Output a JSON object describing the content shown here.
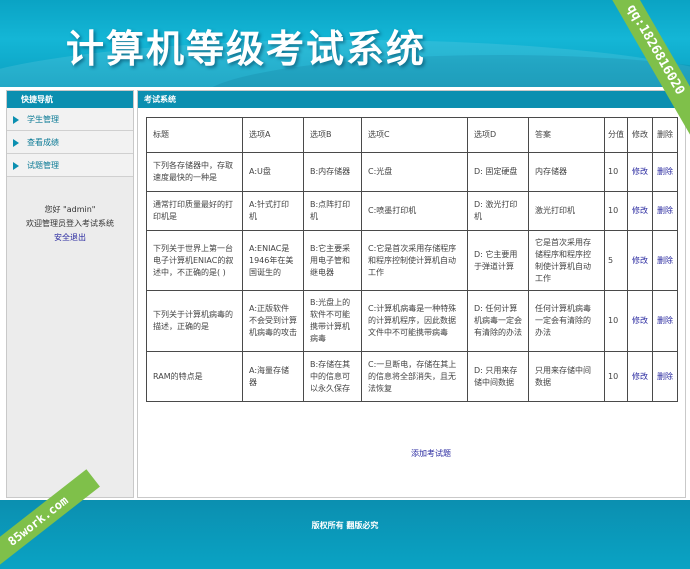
{
  "header": {
    "title": "计算机等级考试系统"
  },
  "watermarks": {
    "top_right": "qq:1826816020",
    "bottom_left": "85work.com"
  },
  "sidebar": {
    "heading": "快捷导航",
    "items": [
      {
        "label": "学生管理"
      },
      {
        "label": "查看成绩"
      },
      {
        "label": "试题管理"
      }
    ],
    "welcome_line1": "您好 \"admin\"",
    "welcome_line2": "欢迎管理员登入考试系统",
    "logout": "安全退出"
  },
  "main": {
    "heading": "考试系统",
    "table": {
      "headers": [
        "标题",
        "选项A",
        "选项B",
        "选项C",
        "选项D",
        "答案",
        "分值",
        "修改",
        "删除"
      ],
      "rows": [
        [
          "下列各存储器中，存取速度最快的一种是",
          "A:U盘",
          "B:内存储器",
          "C:光盘",
          "D: 固定硬盘",
          "内存储器",
          "10",
          "修改",
          "删除"
        ],
        [
          "通常打印质量最好的打印机是",
          "A:针式打印机",
          "B:点阵打印机",
          "C:喷墨打印机",
          "D: 激光打印机",
          "激光打印机",
          "10",
          "修改",
          "删除"
        ],
        [
          "下列关于世界上第一台电子计算机ENIAC的叙述中，不正确的是( )",
          "A:ENIAC是1946年在美国诞生的",
          "B:它主要采用电子管和继电器",
          "C:它是首次采用存储程序和程序控制使计算机自动工作",
          "D: 它主要用于弹道计算",
          "它是首次采用存储程序和程序控制使计算机自动工作",
          "5",
          "修改",
          "删除"
        ],
        [
          "下列关于计算机病毒的描述，正确的是",
          "A:正版软件不会受到计算机病毒的攻击",
          "B:光盘上的软件不可能携带计算机病毒",
          "C:计算机病毒是一种特殊的计算机程序，因此数据文件中不可能携带病毒",
          "D: 任何计算机病毒一定会有清除的办法",
          "任何计算机病毒一定会有清除的办法",
          "10",
          "修改",
          "删除"
        ],
        [
          "RAM的特点是",
          "A:海量存储器",
          "B:存储在其中的信息可以永久保存",
          "C:一旦断电，存储在其上的信息将全部消失，且无法恢复",
          "D: 只用来存储中间数据",
          "只用来存储中间数据",
          "10",
          "修改",
          "删除"
        ]
      ]
    },
    "add_link": "添加考试题"
  },
  "footer": {
    "copyright": "版权所有 翻版必究"
  },
  "colors": {
    "header_bg": "#14b6d6",
    "panel_head": "#0b8fb0",
    "link": "#2a2aa0",
    "watermark": "#7fc04a"
  }
}
